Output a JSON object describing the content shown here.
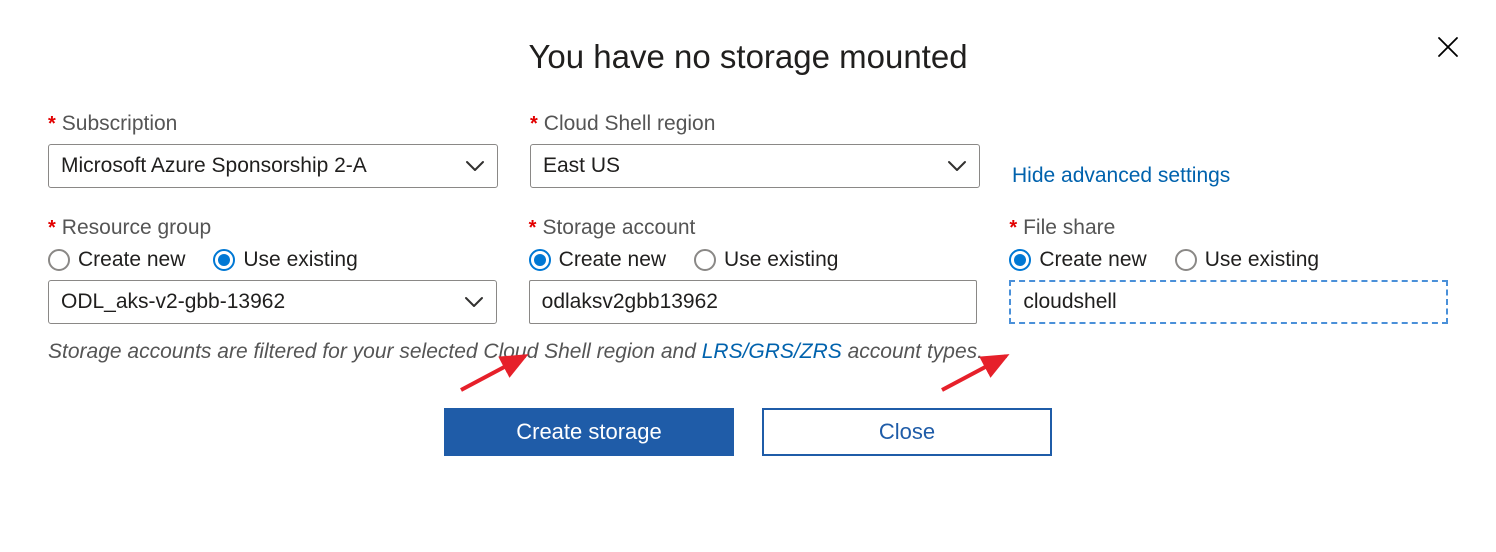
{
  "title": "You have no storage mounted",
  "close_icon": "close",
  "labels": {
    "subscription": "Subscription",
    "cloud_shell_region": "Cloud Shell region",
    "resource_group": "Resource group",
    "storage_account": "Storage account",
    "file_share": "File share"
  },
  "values": {
    "subscription": "Microsoft Azure Sponsorship 2-A",
    "region": "East US",
    "resource_group": "ODL_aks-v2-gbb-13962",
    "storage_account": "odlaksv2gbb13962",
    "file_share": "cloudshell"
  },
  "link": "Hide advanced settings",
  "radio_options": {
    "create_new": "Create new",
    "use_existing": "Use existing"
  },
  "footnote_pre": "Storage accounts are filtered for your selected Cloud Shell region and ",
  "footnote_link": "LRS/GRS/ZRS",
  "footnote_post": " account types.",
  "buttons": {
    "create": "Create storage",
    "close": "Close"
  }
}
